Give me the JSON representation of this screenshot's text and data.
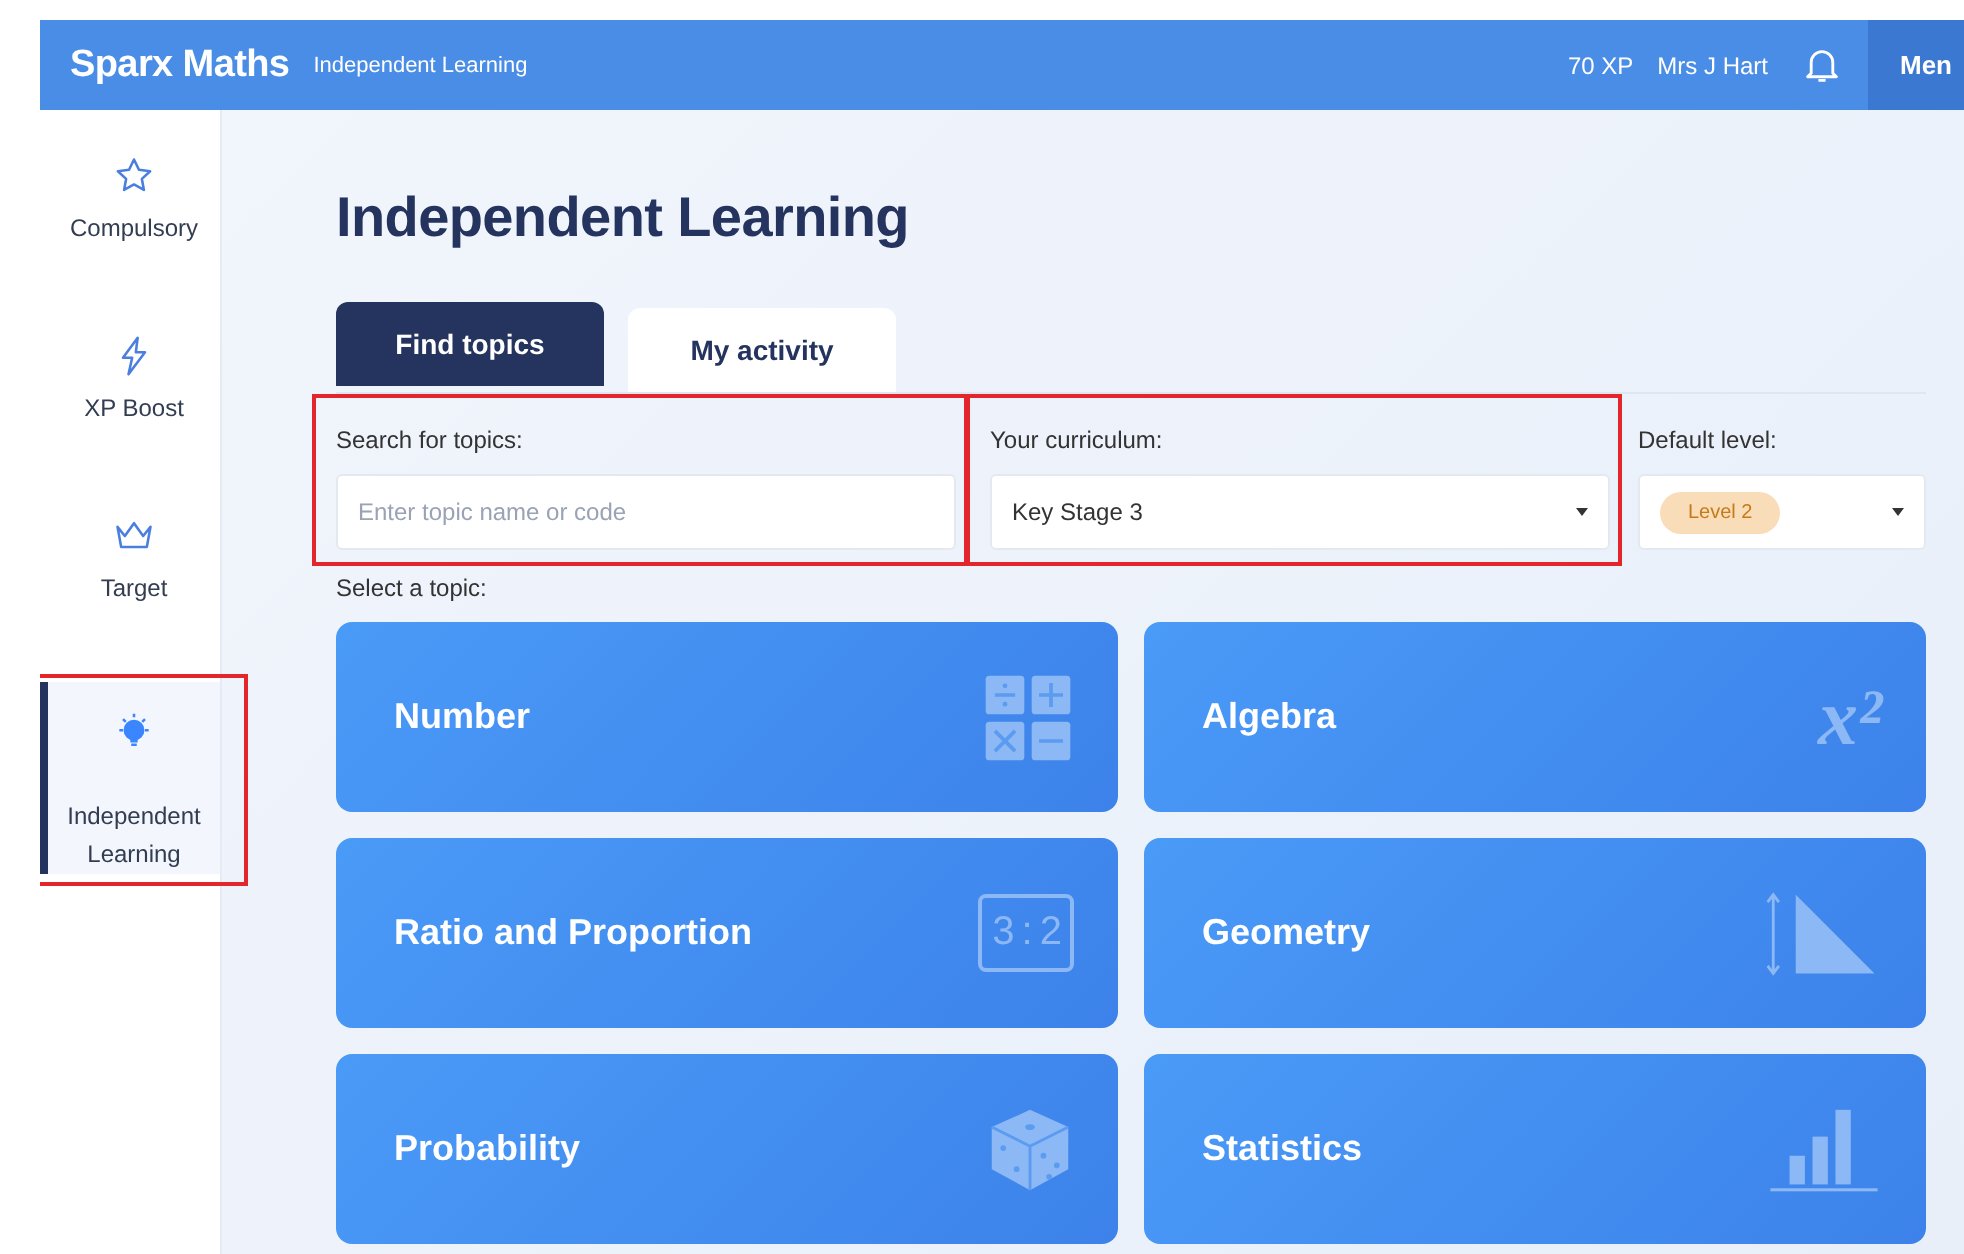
{
  "header": {
    "brand": "Sparx Maths",
    "section": "Independent Learning",
    "xp": "70 XP",
    "user": "Mrs J Hart",
    "menu": "Men"
  },
  "sidebar": {
    "items": [
      {
        "label": "Compulsory",
        "kind": "star",
        "selected": false,
        "highlighted": false
      },
      {
        "label": "XP Boost",
        "kind": "bolt",
        "selected": false,
        "highlighted": false
      },
      {
        "label": "Target",
        "kind": "crown",
        "selected": false,
        "highlighted": false
      },
      {
        "label": "Independent Learning",
        "kind": "bulb",
        "selected": true,
        "highlighted": true
      }
    ]
  },
  "title": "Independent Learning",
  "tabs": [
    {
      "label": "Find topics",
      "selected": true
    },
    {
      "label": "My activity",
      "selected": false
    }
  ],
  "search": {
    "label": "Search for topics:",
    "placeholder": "Enter topic name or code",
    "highlighted": true
  },
  "curriculum": {
    "label": "Your curriculum:",
    "value": "Key Stage 3",
    "highlighted": true
  },
  "level": {
    "label": "Default level:",
    "value": "Level 2"
  },
  "topics_label": "Select a topic:",
  "topics": [
    {
      "name": "Number",
      "kind": "operators"
    },
    {
      "name": "Algebra",
      "kind": "power",
      "icon_text": "x²"
    },
    {
      "name": "Ratio and Proportion",
      "kind": "ratio",
      "icon_text": "3 : 2"
    },
    {
      "name": "Geometry",
      "kind": "triangle"
    },
    {
      "name": "Probability",
      "kind": "dice"
    },
    {
      "name": "Statistics",
      "kind": "bars"
    }
  ]
}
